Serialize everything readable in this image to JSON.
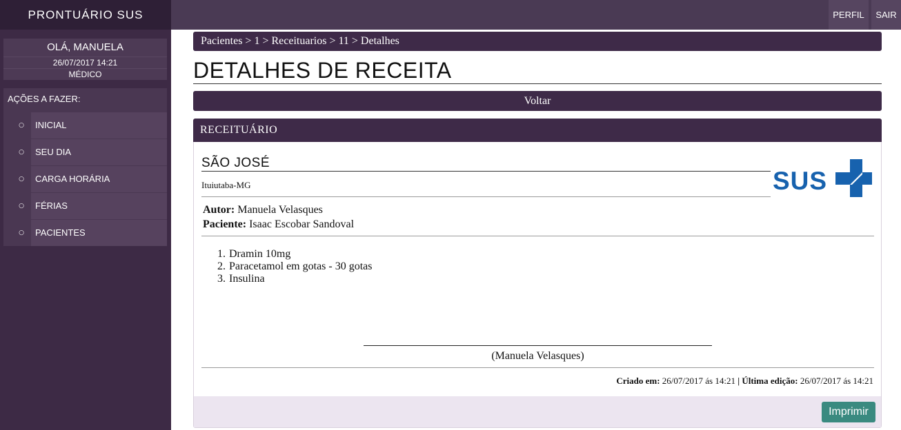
{
  "app": {
    "brand": "PRONTUÁRIO SUS"
  },
  "user": {
    "greeting": "OLÁ, MANUELA",
    "datetime": "26/07/2017 14:21",
    "role": "MÉDICO"
  },
  "sidebar": {
    "actions_title": "AÇÕES A FAZER:",
    "items": [
      {
        "label": "INICIAL"
      },
      {
        "label": "SEU DIA"
      },
      {
        "label": "CARGA HORÁRIA"
      },
      {
        "label": "FÉRIAS"
      },
      {
        "label": "PACIENTES"
      }
    ],
    "bullet": "○"
  },
  "topbar": {
    "profile": "PERFIL",
    "logout": "SAIR"
  },
  "breadcrumb": {
    "items": [
      "Pacientes",
      "1",
      "Receituarios",
      "11",
      "Detalhes"
    ],
    "separator": ">"
  },
  "page": {
    "title": "DETALHES DE RECEITA",
    "back_label": "Voltar"
  },
  "prescription": {
    "header": "RECEITUÁRIO",
    "clinic_name": "SÃO JOSÉ",
    "city": "Ituiutaba-MG",
    "logo_text": "SUS",
    "author_label": "Autor:",
    "author": "Manuela Velasques",
    "patient_label": "Paciente:",
    "patient": "Isaac Escobar Sandoval",
    "medications": [
      {
        "num": "1.",
        "text": "Dramin 10mg"
      },
      {
        "num": "2.",
        "text": "Paracetamol em gotas - 30 gotas"
      },
      {
        "num": "3.",
        "text": "Insulina"
      }
    ],
    "signature": "(Manuela Velasques)",
    "created_label": "Criado em:",
    "created": "26/07/2017 ás 14:21",
    "meta_sep": "|",
    "edited_label": "Última edição:",
    "edited": "26/07/2017 ás 14:21",
    "print_label": "Imprimir"
  },
  "colors": {
    "sidebar_bg": "#3d2a45",
    "brand_bg": "#2e1f36",
    "accent": "#3e2a48",
    "print_button": "#3a8a80",
    "sus_blue": "#1762ae"
  }
}
